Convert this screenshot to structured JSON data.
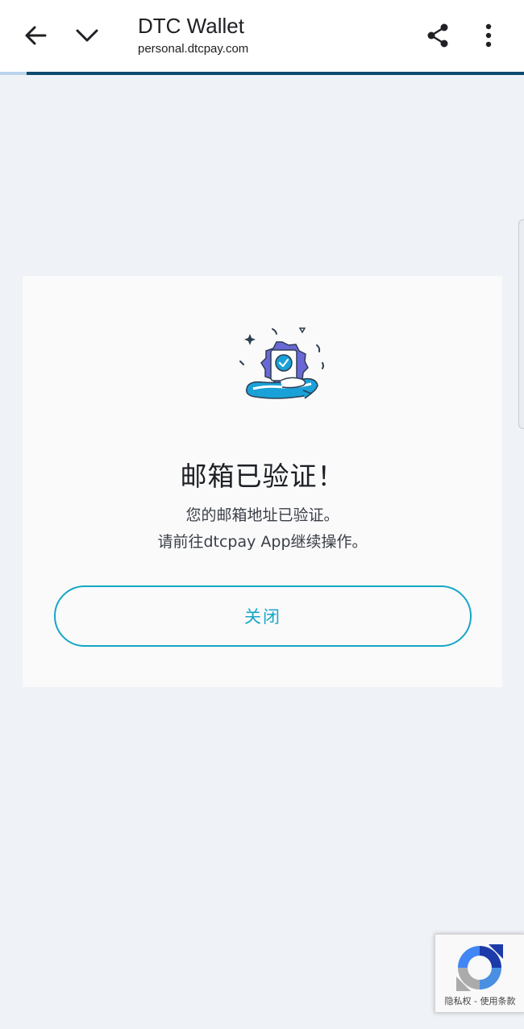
{
  "browser": {
    "title": "DTC Wallet",
    "url": "personal.dtcpay.com",
    "load_progress": 0.05,
    "icons": [
      "arrow-left-icon",
      "chevron-down-icon",
      "share-icon",
      "more-vert-icon"
    ]
  },
  "card": {
    "heading": "邮箱已验证！",
    "message_line1": "您的邮箱地址已验证。",
    "message_line2": "请前往dtcpay App继续操作。",
    "close_label": "关闭",
    "illustration_icon": "verified-badge-icon"
  },
  "recaptcha": {
    "privacy": "隐私权",
    "separator": "-",
    "terms": "使用条款",
    "icon": "recaptcha-icon"
  },
  "colors": {
    "accent": "#15a6c6",
    "background": "#eff2f7",
    "card": "#fafafb",
    "progress_track": "#0e4a6e",
    "badge_purple": "#6a68d6"
  }
}
